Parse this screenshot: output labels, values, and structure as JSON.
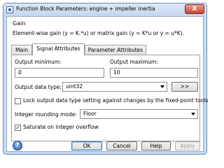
{
  "window": {
    "title": "Function Block Parameters: engine + impeller inertia",
    "close_glyph": "X"
  },
  "header": {
    "group_label": "Gain",
    "description": "Element-wise gain (y = K.*u) or matrix gain (y = K*u or y = u*K)."
  },
  "tabs": [
    {
      "label": "Main",
      "active": false
    },
    {
      "label": "Signal Attributes",
      "active": true
    },
    {
      "label": "Parameter Attributes",
      "active": false
    }
  ],
  "signal_attributes": {
    "output_minimum_label": "Output minimum:",
    "output_minimum_value": "0",
    "output_maximum_label": "Output maximum:",
    "output_maximum_value": "10",
    "output_data_type_label": "Output data type:",
    "output_data_type_value": "uint32",
    "assistant_button_label": ">>",
    "lock_checkbox_label": "Lock output data type setting against changes by the fixed-point tools",
    "lock_checked": false,
    "rounding_label": "Integer rounding mode:",
    "rounding_value": "Floor",
    "saturate_label": "Saturate on integer overflow",
    "saturate_checked": true,
    "check_glyph": "✓"
  },
  "buttons": {
    "help_glyph": "?",
    "ok": "OK",
    "cancel": "Cancel",
    "help": "Help",
    "apply": "Apply"
  }
}
